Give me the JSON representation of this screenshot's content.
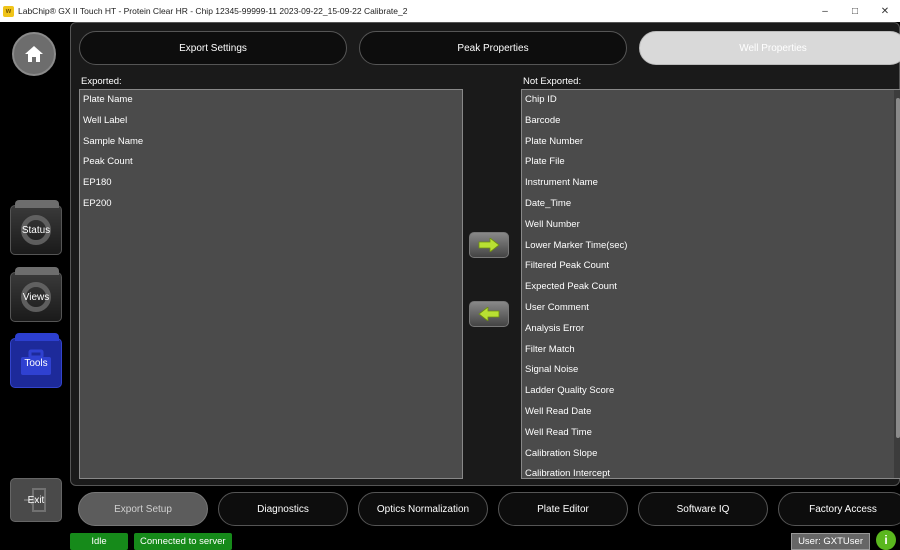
{
  "window": {
    "title": "LabChip® GX II Touch HT - Protein Clear HR - Chip 12345-99999-11 2023-09-22_15-09-22 Calibrate_2",
    "minimize": "–",
    "maximize": "□",
    "close": "✕"
  },
  "sidebar": {
    "status_label": "Status",
    "views_label": "Views",
    "tools_label": "Tools",
    "exit_label": "Exit"
  },
  "top_tabs": [
    {
      "label": "Export Settings"
    },
    {
      "label": "Peak Properties"
    },
    {
      "label": "Well Properties"
    }
  ],
  "exported": {
    "label": "Exported:",
    "items": [
      "Plate Name",
      "Well Label",
      "Sample Name",
      "Peak Count",
      "EP180",
      "EP200"
    ]
  },
  "not_exported": {
    "label": "Not Exported:",
    "items": [
      "Chip ID",
      "Barcode",
      "Plate Number",
      "Plate File",
      "Instrument Name",
      "Date_Time",
      "Well Number",
      "Lower Marker Time(sec)",
      "Filtered Peak Count",
      "Expected Peak Count",
      "User Comment",
      "Analysis Error",
      "Filter Match",
      "Signal Noise",
      "Ladder Quality Score",
      "Well Read Date",
      "Well Read Time",
      "Calibration Slope",
      "Calibration Intercept"
    ]
  },
  "bottom_tabs": [
    {
      "label": "Export Setup"
    },
    {
      "label": "Diagnostics"
    },
    {
      "label": "Optics Normalization"
    },
    {
      "label": "Plate Editor"
    },
    {
      "label": "Software IQ"
    },
    {
      "label": "Factory Access"
    }
  ],
  "status_bar": {
    "state": "Idle",
    "connection": "Connected to server",
    "user": "User: GXTUser",
    "info": "i"
  },
  "colors": {
    "accent_green": "#5ab71e",
    "status_green": "#168a1a",
    "tools_blue": "#1d2a9a"
  }
}
